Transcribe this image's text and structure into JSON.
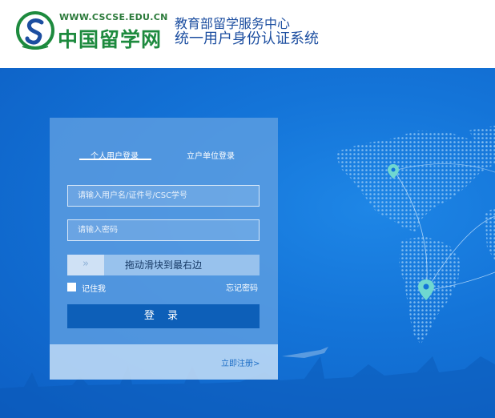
{
  "header": {
    "logo_url_text": "WWW.CSCSE.EDU.CN",
    "logo_cn_text": "中国留学网",
    "title": "教育部留学服务中心",
    "subtitle": "统一用户身份认证系统"
  },
  "login": {
    "tabs": [
      {
        "label": "个人用户登录",
        "active": true
      },
      {
        "label": "立户单位登录",
        "active": false
      }
    ],
    "username_placeholder": "请输入用户名/证件号/CSC学号",
    "password_placeholder": "请输入密码",
    "slider_text": "拖动滑块到最右边",
    "slider_handle_icon": "»",
    "remember_label": "记住我",
    "forgot_label": "忘记密码",
    "login_button": "登 录",
    "register_link": "立即注册>"
  },
  "colors": {
    "brand_green": "#1d8a3e",
    "header_text": "#1c4ea0",
    "hero_blue": "#1474d8",
    "button_blue": "#0d5fb8",
    "pin_teal": "#6fd7d0"
  },
  "icons": {
    "logo": "cscse-logo-icon",
    "slider": "double-chevron-right-icon",
    "pin": "map-pin-icon"
  }
}
